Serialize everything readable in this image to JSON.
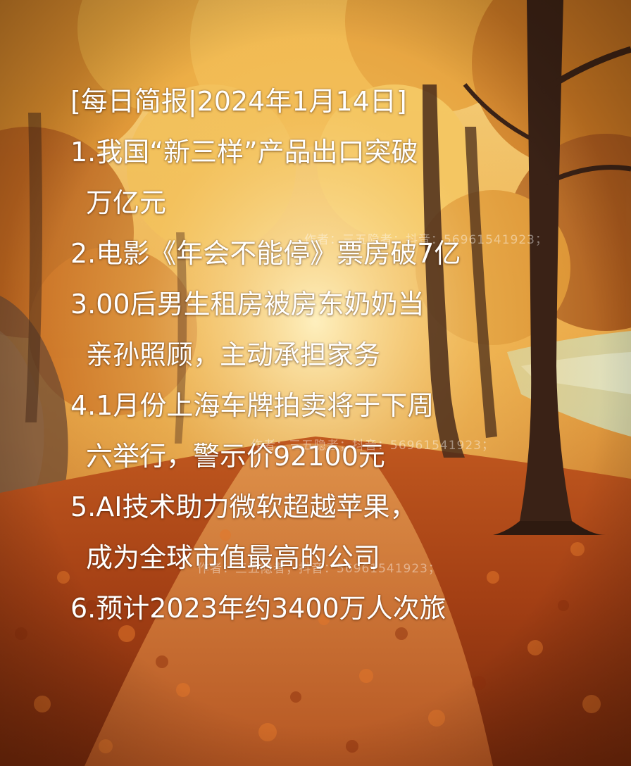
{
  "title": "[每日简报|2024年1月14日]",
  "items": [
    {
      "lines": [
        "1.我国“新三样”产品出口突破",
        "万亿元"
      ]
    },
    {
      "lines": [
        "2.电影《年会不能停》票房破7亿"
      ]
    },
    {
      "lines": [
        "3.00后男生租房被房东奶奶当",
        "亲孙照顾，主动承担家务"
      ]
    },
    {
      "lines": [
        "4.1月份上海车牌拍卖将于下周",
        "六举行，警示价92100元"
      ]
    },
    {
      "lines": [
        "5.AI技术助力微软超越苹果，",
        "成为全球市值最高的公司"
      ]
    },
    {
      "lines": [
        "6.预计2023年约3400万人次旅"
      ]
    }
  ],
  "watermark": "作者：三五隐者；抖音：56961541923；",
  "colors": {
    "text": "#ffffff",
    "foliage_light": "#f3c35a",
    "foliage_dark": "#b8551a",
    "ground": "#9c3a12",
    "trunk": "#3a2216",
    "meadow": "#cfd9b4"
  }
}
